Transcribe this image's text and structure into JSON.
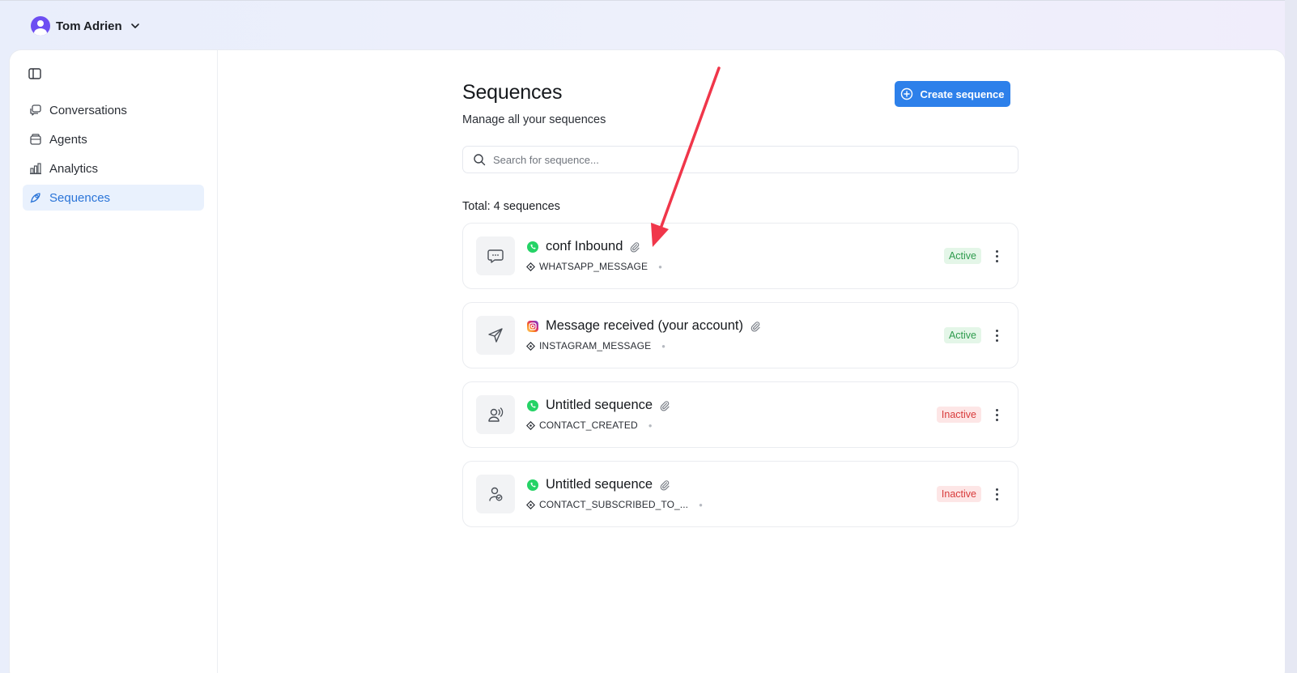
{
  "account": {
    "name": "Tom Adrien"
  },
  "sidebar": {
    "items": [
      {
        "label": "Conversations",
        "icon": "conversations-icon",
        "active": false
      },
      {
        "label": "Agents",
        "icon": "agents-icon",
        "active": false
      },
      {
        "label": "Analytics",
        "icon": "analytics-icon",
        "active": false
      },
      {
        "label": "Sequences",
        "icon": "sequences-icon",
        "active": true
      }
    ]
  },
  "page": {
    "title": "Sequences",
    "subtitle": "Manage all your sequences",
    "create_button": "Create sequence",
    "search_placeholder": "Search for sequence...",
    "total": "Total: 4 sequences"
  },
  "sequences": [
    {
      "title": "conf Inbound",
      "channel": "whatsapp",
      "trigger": "WHATSAPP_MESSAGE",
      "status": "Active",
      "icon": "chat-bubble-icon"
    },
    {
      "title": "Message received (your account)",
      "channel": "instagram",
      "trigger": "INSTAGRAM_MESSAGE",
      "status": "Active",
      "icon": "send-icon"
    },
    {
      "title": "Untitled sequence",
      "channel": "whatsapp",
      "trigger": "CONTACT_CREATED",
      "status": "Inactive",
      "icon": "user-signal-icon"
    },
    {
      "title": "Untitled sequence",
      "channel": "whatsapp",
      "trigger": "CONTACT_SUBSCRIBED_TO_...",
      "status": "Inactive",
      "icon": "user-check-icon"
    }
  ],
  "colors": {
    "accent": "#2d80ea",
    "active_text": "#2e9b4d",
    "active_bg": "#e4f6e8",
    "inactive_text": "#d83a3a",
    "inactive_bg": "#fde6e6",
    "annotation_arrow": "#f0364a",
    "whatsapp": "#25d366"
  }
}
